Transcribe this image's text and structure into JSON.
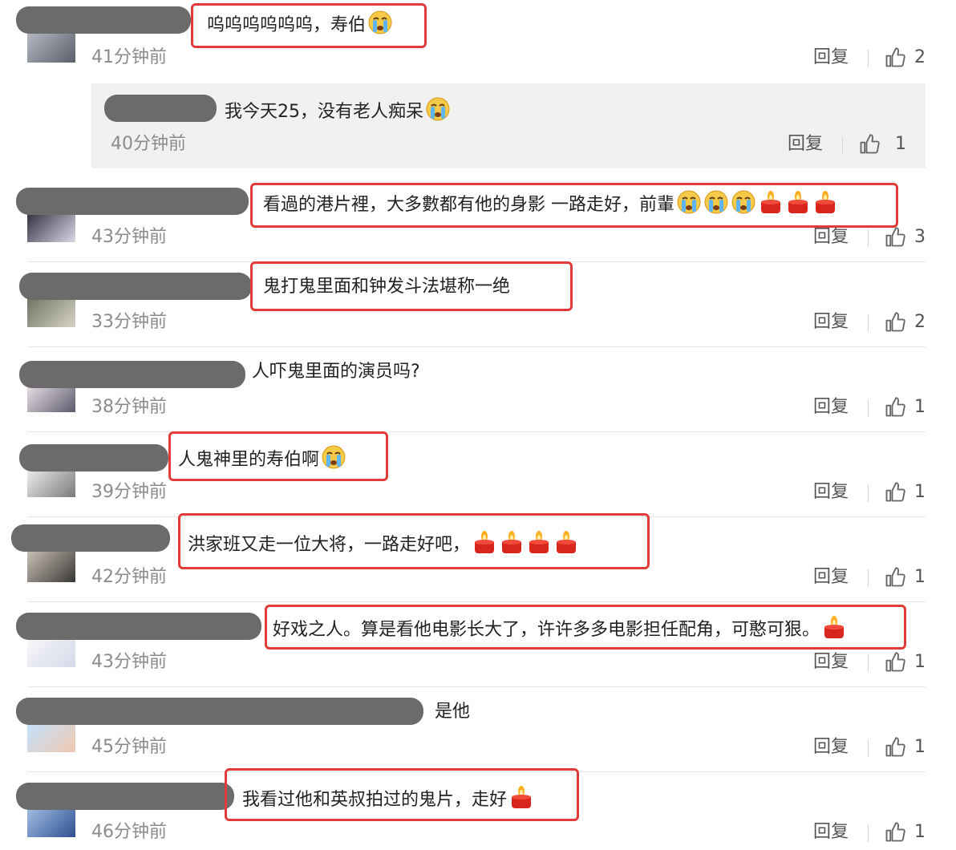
{
  "reply_label": "回复",
  "comments": [
    {
      "text": "呜呜呜呜呜呜，寿伯",
      "emojis": [
        "cry"
      ],
      "time": "41分钟前",
      "likes": "2"
    },
    {
      "text": "看過的港片裡，大多數都有他的身影 一路走好，前輩",
      "emojis": [
        "cry",
        "cry",
        "cry",
        "candle",
        "candle",
        "candle"
      ],
      "time": "43分钟前",
      "likes": "3"
    },
    {
      "text": "鬼打鬼里面和钟发斗法堪称一绝",
      "emojis": [],
      "time": "33分钟前",
      "likes": "2"
    },
    {
      "text": "人吓鬼里面的演员吗?",
      "emojis": [],
      "time": "38分钟前",
      "likes": "1"
    },
    {
      "text": "人鬼神里的寿伯啊",
      "emojis": [
        "cry"
      ],
      "time": "39分钟前",
      "likes": "1"
    },
    {
      "text": "洪家班又走一位大将，一路走好吧，",
      "emojis": [
        "candle",
        "candle",
        "candle",
        "candle"
      ],
      "time": "42分钟前",
      "likes": "1"
    },
    {
      "text": "好戏之人。算是看他电影长大了，许许多多电影担任配角，可憨可狠。",
      "emojis": [
        "candle"
      ],
      "time": "43分钟前",
      "likes": "1"
    },
    {
      "text": "是他",
      "emojis": [],
      "time": "45分钟前",
      "likes": "1"
    },
    {
      "text": "我看过他和英叔拍过的鬼片，走好",
      "emojis": [
        "candle"
      ],
      "time": "46分钟前",
      "likes": "1"
    }
  ],
  "nested_reply": {
    "text": "我今天25，没有老人痴呆",
    "emojis": [
      "cry"
    ],
    "time": "40分钟前",
    "likes": "1"
  },
  "colors": {
    "highlight": "#e23b3b",
    "mask": "#6b6b6b",
    "reply_bg": "#f1f1f1"
  }
}
